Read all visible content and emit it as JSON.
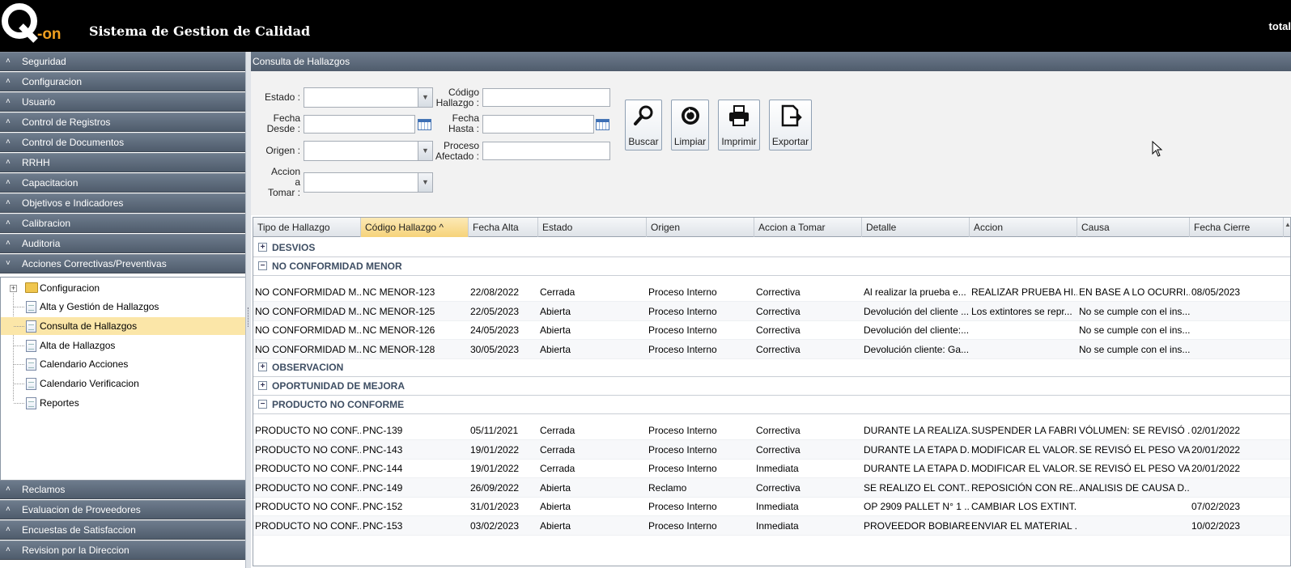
{
  "header": {
    "title": "Sistema de Gestion de Calidad",
    "user": "total",
    "logo_text": "Q-on"
  },
  "sidebar": {
    "top_sections": [
      "Seguridad",
      "Configuracion",
      "Usuario",
      "Control de Registros",
      "Control de Documentos",
      "RRHH",
      "Capacitacion",
      "Objetivos e Indicadores",
      "Calibracion",
      "Auditoria",
      "Acciones Correctivas/Preventivas"
    ],
    "tree": [
      {
        "label": "Configuracion",
        "type": "folder"
      },
      {
        "label": "Alta y Gestión de Hallazgos",
        "type": "page"
      },
      {
        "label": "Consulta de Hallazgos",
        "type": "page",
        "selected": true
      },
      {
        "label": "Alta de Hallazgos",
        "type": "page"
      },
      {
        "label": "Calendario Acciones",
        "type": "page"
      },
      {
        "label": "Calendario Verificacion",
        "type": "page"
      },
      {
        "label": "Reportes",
        "type": "page"
      }
    ],
    "bottom_sections": [
      "Reclamos",
      "Evaluacion de Proveedores",
      "Encuestas de Satisfaccion",
      "Revision por la Direccion"
    ]
  },
  "main": {
    "title": "Consulta de Hallazgos",
    "filters": {
      "estado": "Estado :",
      "codigo_1": "Código",
      "codigo_2": "Hallazgo :",
      "fecha_desde_1": "Fecha",
      "fecha_desde_2": "Desde :",
      "fecha_hasta_1": "Fecha",
      "fecha_hasta_2": "Hasta :",
      "origen": "Origen :",
      "proceso_1": "Proceso",
      "proceso_2": "Afectado :",
      "accion_1": "Accion",
      "accion_2": "a",
      "accion_3": "Tomar :"
    },
    "buttons": {
      "buscar": "Buscar",
      "limpiar": "Limpiar",
      "imprimir": "Imprimir",
      "exportar": "Exportar"
    },
    "columns": [
      "Tipo de Hallazgo",
      "Código Hallazgo",
      "Fecha Alta",
      "Estado",
      "Origen",
      "Accion a Tomar",
      "Detalle",
      "Accion",
      "Causa",
      "Fecha Cierre"
    ],
    "sort_indicator": "^",
    "groups": [
      {
        "name": "DESVIOS",
        "expanded": false,
        "rows": []
      },
      {
        "name": "NO CONFORMIDAD MENOR",
        "expanded": true,
        "rows": [
          [
            "NO CONFORMIDAD M...",
            "NC MENOR-123",
            "22/08/2022",
            "Cerrada",
            "Proceso Interno",
            "Correctiva",
            "Al realizar la prueba e...",
            "REALIZAR PRUEBA HI...",
            "EN BASE A LO OCURRI...",
            "08/05/2023"
          ],
          [
            "NO CONFORMIDAD M...",
            "NC MENOR-125",
            "22/05/2023",
            "Abierta",
            "Proceso Interno",
            "Correctiva",
            "Devolución del cliente ...",
            "Los extintores se repr...",
            "No se cumple con el ins...",
            ""
          ],
          [
            "NO CONFORMIDAD M...",
            "NC MENOR-126",
            "24/05/2023",
            "Abierta",
            "Proceso Interno",
            "Correctiva",
            "Devolución del cliente:...",
            "",
            "No se cumple con el ins...",
            ""
          ],
          [
            "NO CONFORMIDAD M...",
            "NC MENOR-128",
            "30/05/2023",
            "Abierta",
            "Proceso Interno",
            "Correctiva",
            "Devolución cliente: Ga...",
            "",
            "No se cumple con el ins...",
            ""
          ]
        ]
      },
      {
        "name": "OBSERVACION",
        "expanded": false,
        "rows": []
      },
      {
        "name": "OPORTUNIDAD DE MEJORA",
        "expanded": false,
        "rows": []
      },
      {
        "name": "PRODUCTO NO CONFORME",
        "expanded": true,
        "rows": [
          [
            "PRODUCTO NO CONF...",
            "PNC-139",
            "05/11/2021",
            "Cerrada",
            "Proceso Interno",
            "Correctiva",
            "DURANTE LA REALIZA...",
            "SUSPENDER LA FABRI...",
            "VÓLUMEN: SE REVISÓ ...",
            "02/01/2022"
          ],
          [
            "PRODUCTO NO CONF...",
            "PNC-143",
            "19/01/2022",
            "Cerrada",
            "Proceso Interno",
            "Correctiva",
            "DURANTE LA ETAPA D...",
            "MODIFICAR EL VALOR...",
            "SE REVISÓ EL PESO VA...",
            "20/01/2022"
          ],
          [
            "PRODUCTO NO CONF...",
            "PNC-144",
            "19/01/2022",
            "Cerrada",
            "Proceso Interno",
            "Inmediata",
            "DURANTE LA ETAPA D...",
            "MODIFICAR EL VALOR...",
            "SE REVISÓ EL PESO VA...",
            "20/01/2022"
          ],
          [
            "PRODUCTO NO CONF...",
            "PNC-149",
            "26/09/2022",
            "Abierta",
            "Reclamo",
            "Correctiva",
            "SE REALIZO EL CONT...",
            "REPOSICIÓN CON RE...",
            "ANALISIS DE CAUSA D...",
            ""
          ],
          [
            "PRODUCTO NO CONF...",
            "PNC-152",
            "31/01/2023",
            "Abierta",
            "Proceso Interno",
            "Inmediata",
            "OP 2909 PALLET N° 1 ...",
            "CAMBIAR LOS EXTINT...",
            "",
            "07/02/2023"
          ],
          [
            "PRODUCTO NO CONF...",
            "PNC-153",
            "03/02/2023",
            "Abierta",
            "Proceso Interno",
            "Inmediata",
            "PROVEEDOR BOBIARE...",
            "ENVIAR EL MATERIAL ...",
            "",
            "10/02/2023"
          ]
        ]
      }
    ]
  },
  "colors": {
    "header_bg": "#000000",
    "nav_bar": "#5e6b7b",
    "selected_item": "#fbe6a8",
    "group_text": "#3e4e63"
  }
}
